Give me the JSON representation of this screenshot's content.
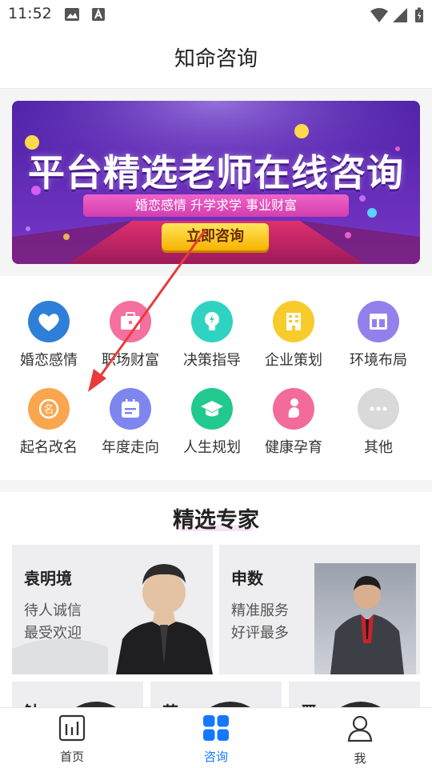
{
  "status_bar": {
    "time": "11:52",
    "icons": [
      "image-icon",
      "a-icon",
      "wifi-icon",
      "signal-icon",
      "battery-icon"
    ]
  },
  "header": {
    "title": "知命咨询"
  },
  "banner": {
    "title": "平台精选老师在线咨询",
    "tags": "婚恋感情   升学求学   事业财富",
    "button": "立即咨询"
  },
  "categories": [
    {
      "label": "婚恋感情",
      "icon": "heart-icon",
      "color": "#2f7fd8"
    },
    {
      "label": "职场财富",
      "icon": "briefcase-icon",
      "color": "#f56fa0"
    },
    {
      "label": "决策指导",
      "icon": "bulb-icon",
      "color": "#2fd3c2"
    },
    {
      "label": "企业策划",
      "icon": "building-icon",
      "color": "#f7cb2a"
    },
    {
      "label": "环境布局",
      "icon": "layout-icon",
      "color": "#9480ec"
    },
    {
      "label": "起名改名",
      "icon": "name-icon",
      "color": "#f9a64f"
    },
    {
      "label": "年度走向",
      "icon": "calendar-icon",
      "color": "#7d86ef"
    },
    {
      "label": "人生规划",
      "icon": "graduation-cap-icon",
      "color": "#22c98f"
    },
    {
      "label": "健康孕育",
      "icon": "baby-icon",
      "color": "#f26b9a"
    },
    {
      "label": "其他",
      "icon": "more-icon",
      "color": "#d9d9d9"
    }
  ],
  "experts_section": {
    "title": "精选专家",
    "experts": [
      {
        "name": "袁明境",
        "desc1": "待人诚信",
        "desc2": "最受欢迎"
      },
      {
        "name": "申数",
        "desc1": "精准服务",
        "desc2": "好评最多"
      }
    ],
    "partial_names": [
      "钟",
      "苏",
      "严"
    ]
  },
  "tabs": [
    {
      "label": "首页",
      "icon": "home-icon",
      "active": false
    },
    {
      "label": "咨询",
      "icon": "grid-icon",
      "active": true
    },
    {
      "label": "我",
      "icon": "profile-icon",
      "active": false
    }
  ],
  "colors": {
    "accent": "#1677ff",
    "annotation": "#e83b3b",
    "banner_bg": "#6a2fc0"
  }
}
